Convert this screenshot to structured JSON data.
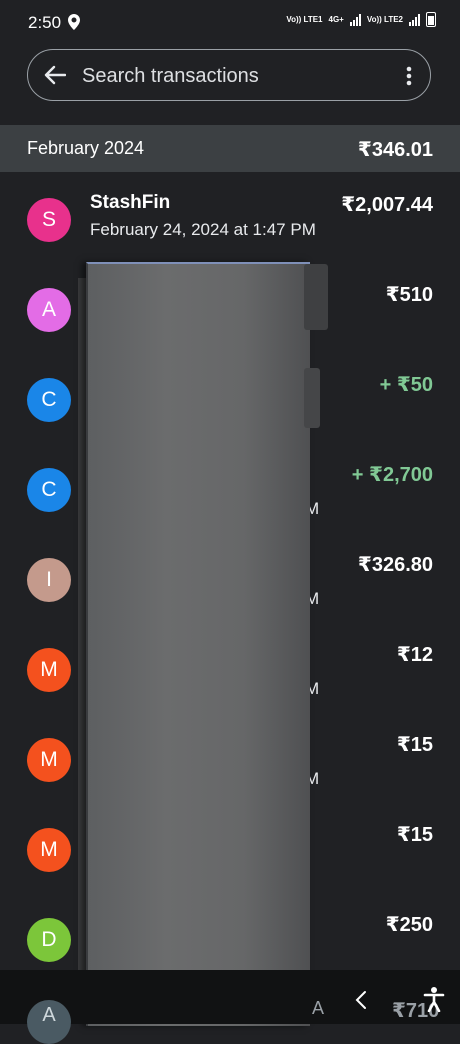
{
  "status_bar": {
    "time": "2:50",
    "net1": "Vo)) LTE1",
    "net2": "4G+",
    "net3": "Vo)) LTE2"
  },
  "search": {
    "placeholder": "Search transactions"
  },
  "month_header": {
    "label": "February 2024",
    "total": "₹346.01"
  },
  "transactions": [
    {
      "initial": "S",
      "color": "#e8318c",
      "name": "StashFin",
      "date": "February 24, 2024 at 1:47 PM",
      "amount": "₹2,007.44",
      "credit": false,
      "tail": ""
    },
    {
      "initial": "A",
      "color": "#e36ce6",
      "name": "",
      "date": "",
      "amount": "₹510",
      "credit": false,
      "tail": ""
    },
    {
      "initial": "C",
      "color": "#1a86e8",
      "name": "",
      "date": "",
      "amount": "+ ₹50",
      "credit": true,
      "tail": ""
    },
    {
      "initial": "C",
      "color": "#1a86e8",
      "name": "",
      "date": "",
      "amount": "+ ₹2,700",
      "credit": true,
      "tail": "M"
    },
    {
      "initial": "I",
      "color": "#c49a8c",
      "name": "",
      "date": "",
      "amount": "₹326.80",
      "credit": false,
      "tail": "M"
    },
    {
      "initial": "M",
      "color": "#f4511e",
      "name": "",
      "date": "",
      "amount": "₹12",
      "credit": false,
      "tail": "M"
    },
    {
      "initial": "M",
      "color": "#f4511e",
      "name": "",
      "date": "",
      "amount": "₹15",
      "credit": false,
      "tail": "M"
    },
    {
      "initial": "M",
      "color": "#f4511e",
      "name": "",
      "date": "",
      "amount": "₹15",
      "credit": false,
      "tail": ""
    },
    {
      "initial": "D",
      "color": "#7cc63a",
      "name": "",
      "date": "",
      "amount": "₹250",
      "credit": false,
      "tail": ""
    }
  ],
  "partial_row": {
    "initial": "A",
    "letter": "A",
    "amount": "₹710"
  },
  "icons": {
    "back": "arrow-left-icon",
    "more": "more-vert-icon",
    "nav_back": "chevron-left-icon",
    "accessibility": "accessibility-icon",
    "location": "location-pin-icon"
  }
}
